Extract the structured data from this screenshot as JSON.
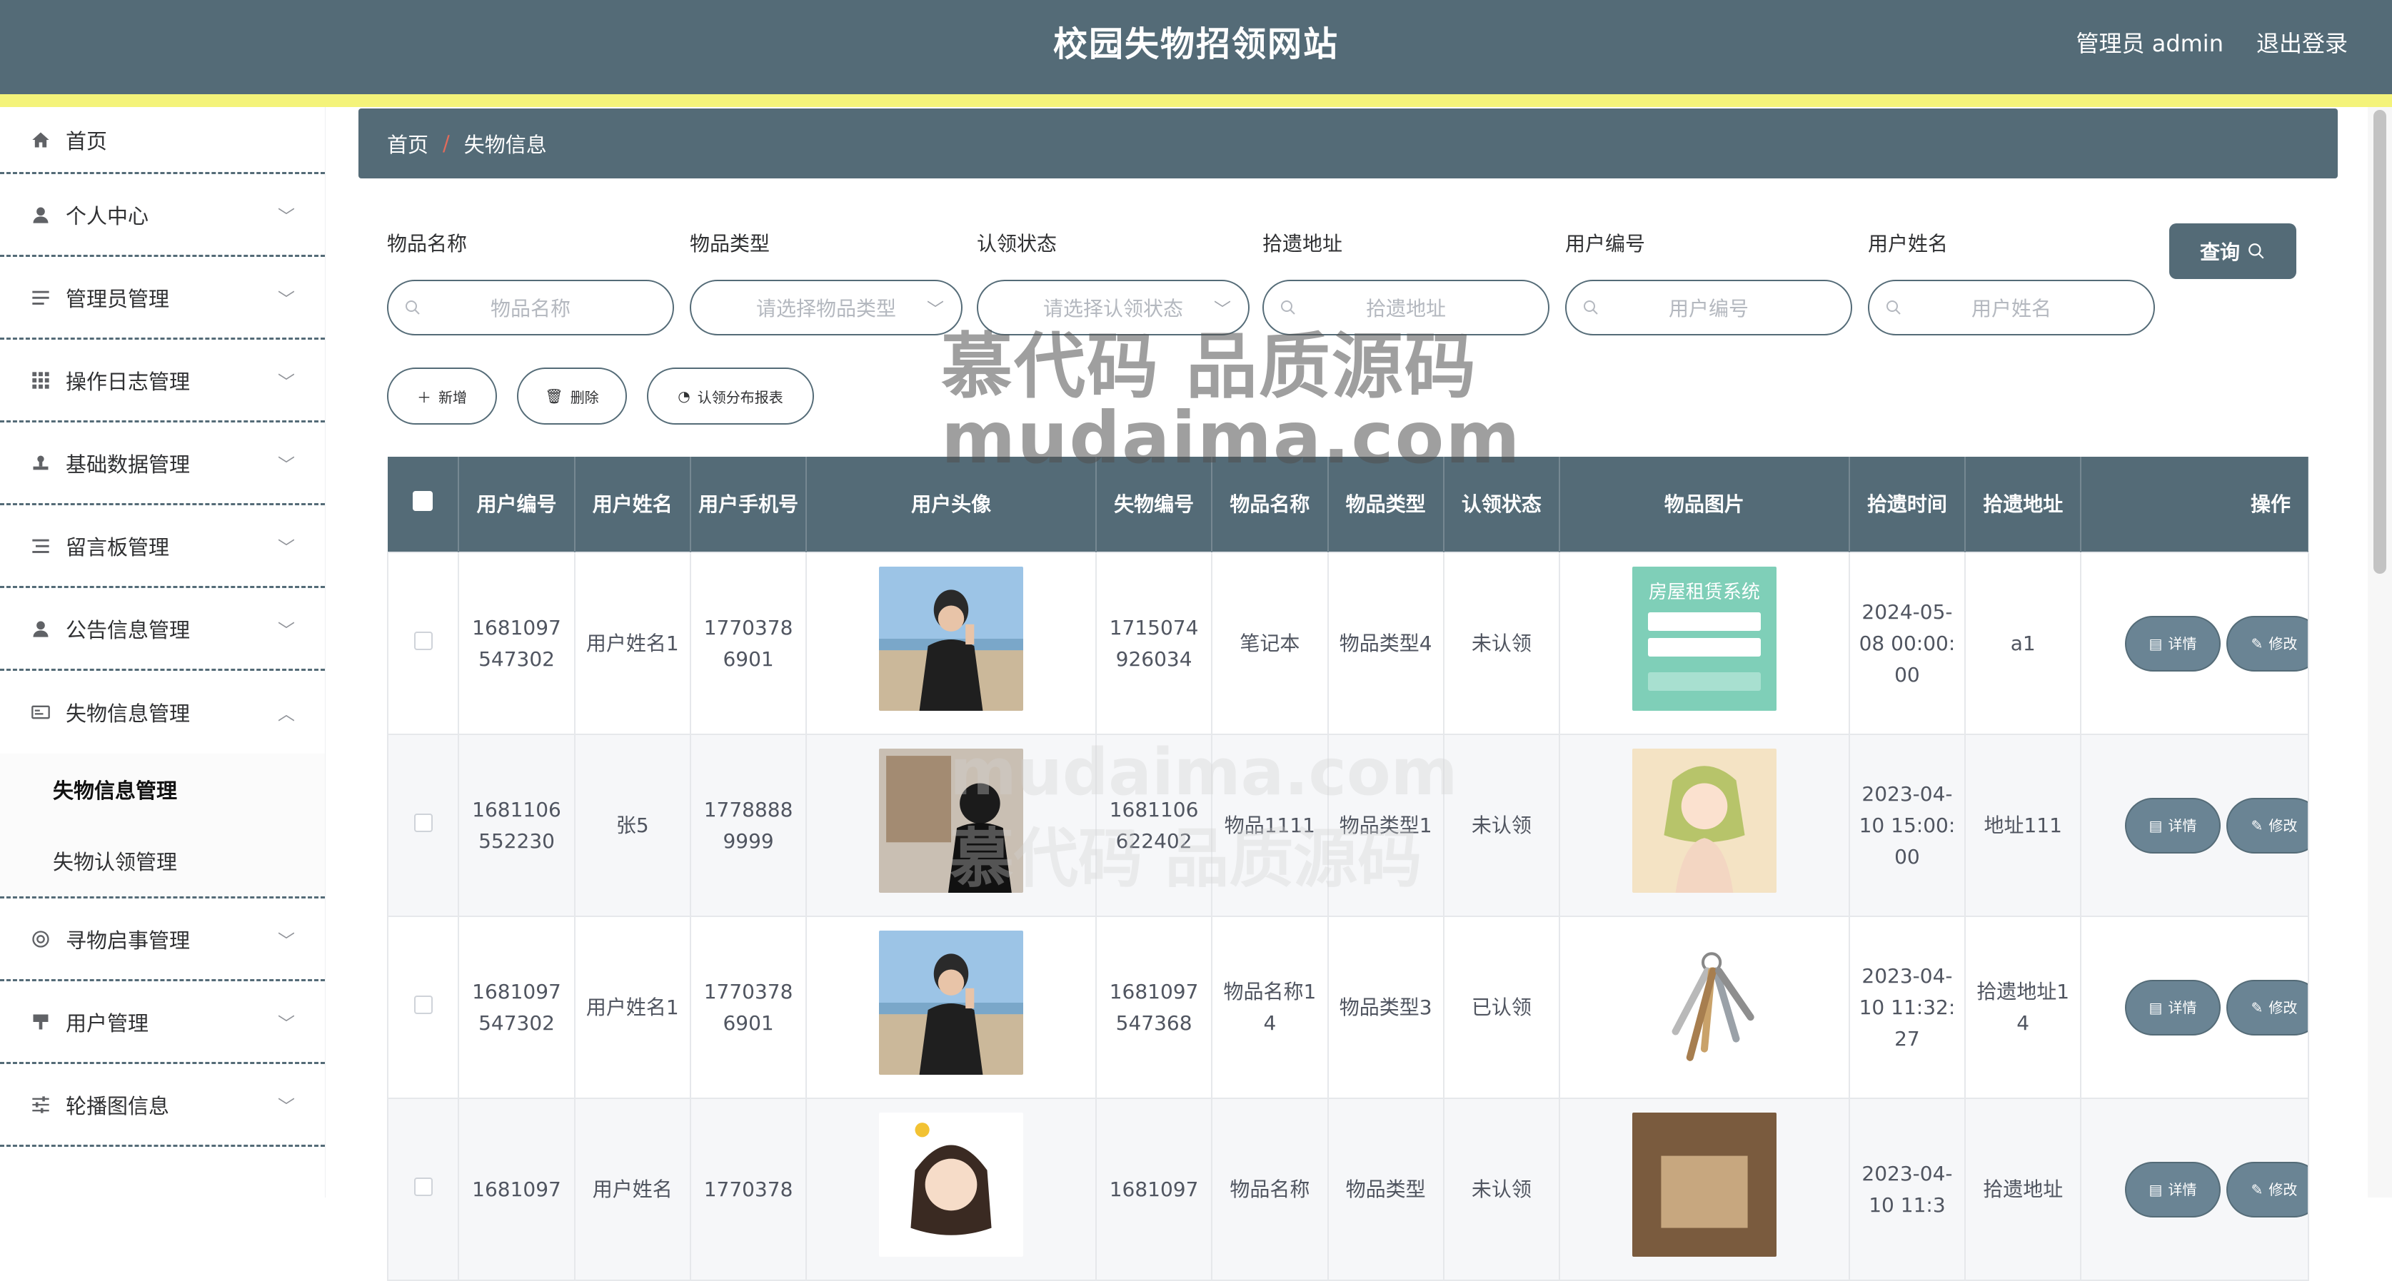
{
  "header": {
    "title": "校园失物招领网站",
    "admin_label": "管理员 admin",
    "logout": "退出登录"
  },
  "sidebar": {
    "items": [
      {
        "label": "首页",
        "icon": "home-icon"
      },
      {
        "label": "个人中心",
        "icon": "user-icon"
      },
      {
        "label": "管理员管理",
        "icon": "list-icon"
      },
      {
        "label": "操作日志管理",
        "icon": "grid-icon"
      },
      {
        "label": "基础数据管理",
        "icon": "stamp-icon"
      },
      {
        "label": "留言板管理",
        "icon": "list-icon"
      },
      {
        "label": "公告信息管理",
        "icon": "user-icon"
      },
      {
        "label": "失物信息管理",
        "icon": "card-icon"
      },
      {
        "label": "寻物启事管理",
        "icon": "lifebuoy-icon"
      },
      {
        "label": "用户管理",
        "icon": "tag-icon"
      },
      {
        "label": "轮播图信息",
        "icon": "sliders-icon"
      }
    ],
    "submenu": [
      "失物信息管理",
      "失物认领管理"
    ]
  },
  "breadcrumb": {
    "home": "首页",
    "sep": "/",
    "current": "失物信息"
  },
  "filters": [
    {
      "label": "物品名称",
      "placeholder": "物品名称"
    },
    {
      "label": "物品类型",
      "placeholder": "请选择物品类型"
    },
    {
      "label": "认领状态",
      "placeholder": "请选择认领状态"
    },
    {
      "label": "拾遗地址",
      "placeholder": "拾遗地址"
    },
    {
      "label": "用户编号",
      "placeholder": "用户编号"
    },
    {
      "label": "用户姓名",
      "placeholder": "用户姓名"
    }
  ],
  "query_label": "查询",
  "actions": {
    "add": "新增",
    "delete": "删除",
    "report": "认领分布报表"
  },
  "table": {
    "headers": [
      "用户编号",
      "用户姓名",
      "用户手机号",
      "用户头像",
      "失物编号",
      "物品名称",
      "物品类型",
      "认领状态",
      "物品图片",
      "拾遗时间",
      "拾遗地址",
      "操作"
    ],
    "rows": [
      {
        "user_no": "1681097547302",
        "user_name": "用户姓名1",
        "phone": "17703786901",
        "lost_no": "1715074926034",
        "item": "笔记本",
        "type": "物品类型4",
        "status": "未认领",
        "time": "2024-05-08 00:00:00",
        "addr": "a1",
        "img_text": "房屋租赁系统"
      },
      {
        "user_no": "1681106552230",
        "user_name": "张5",
        "phone": "17788889999",
        "lost_no": "1681106622402",
        "item": "物品1111",
        "type": "物品类型1",
        "status": "未认领",
        "time": "2023-04-10 15:00:00",
        "addr": "地址111"
      },
      {
        "user_no": "1681097547302",
        "user_name": "用户姓名1",
        "phone": "17703786901",
        "lost_no": "1681097547368",
        "item": "物品名称14",
        "type": "物品类型3",
        "status": "已认领",
        "time": "2023-04-10 11:32:27",
        "addr": "拾遗地址14"
      },
      {
        "user_no": "1681097",
        "user_name": "用户姓名",
        "phone": "1770378",
        "lost_no": "1681097",
        "item": "物品名称",
        "type": "物品类型",
        "status": "未认领",
        "time": "2023-04-10 11:3",
        "addr": "拾遗地址"
      }
    ],
    "detail_label": "详情",
    "edit_label": "修改"
  },
  "watermark": {
    "cn": "慕代码 品质源码",
    "en": "mudaima.com"
  },
  "colors": {
    "primary": "#546b77",
    "accent_strip": "#f4f37a",
    "breadcrumb_sep": "#e06b5b"
  }
}
